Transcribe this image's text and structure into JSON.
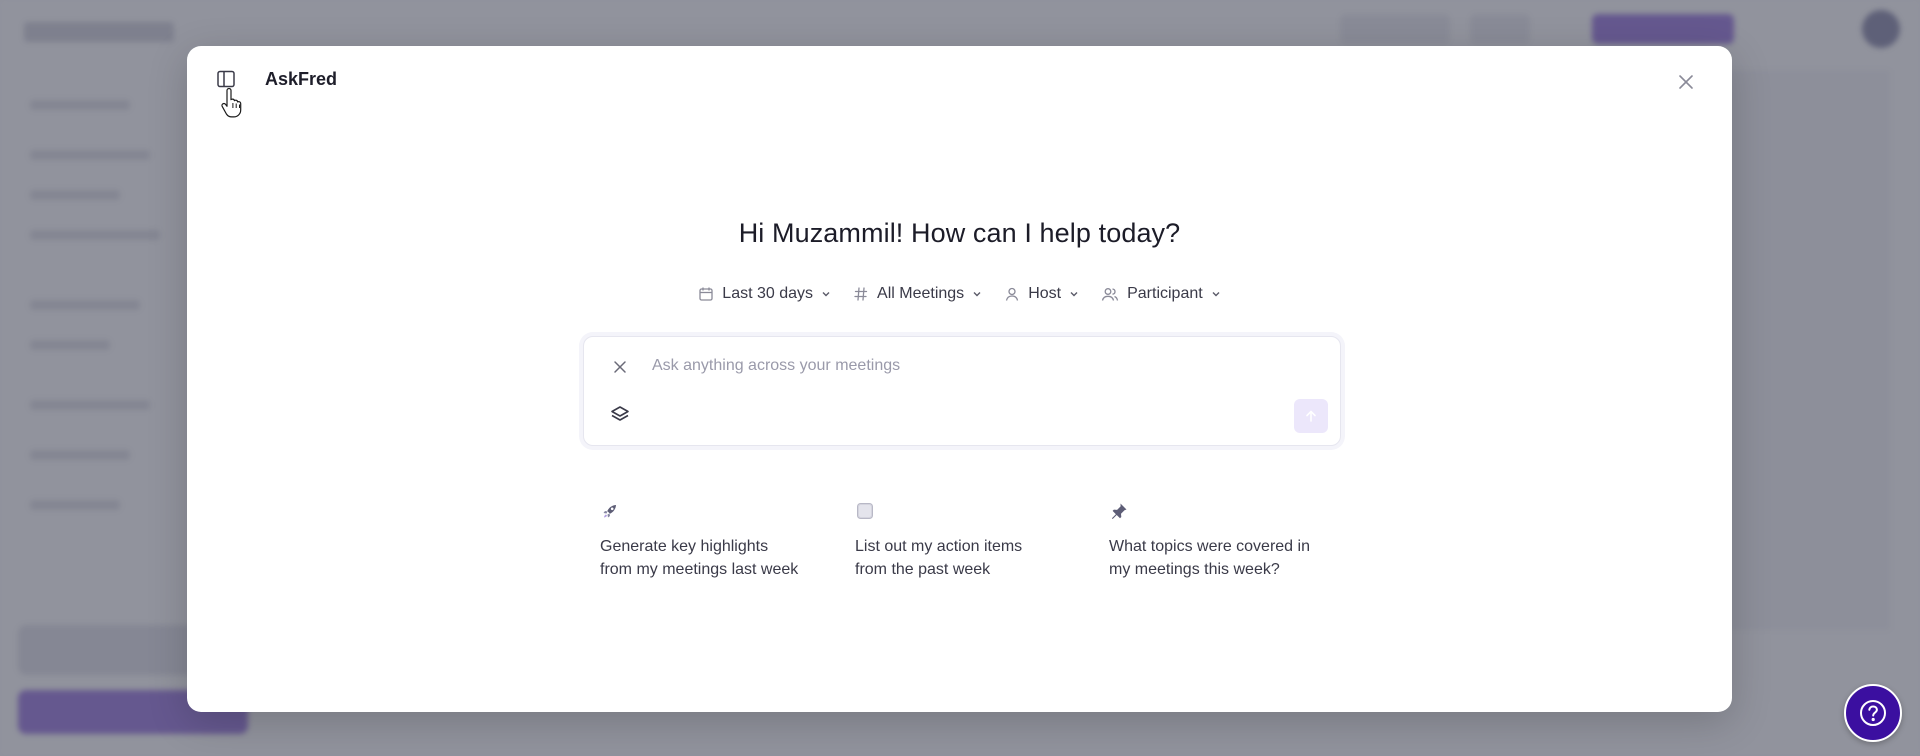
{
  "modal": {
    "title": "AskFred",
    "greeting": "Hi Muzammil! How can I help today?"
  },
  "filters": [
    {
      "label": "Last 30 days",
      "icon": "calendar-icon"
    },
    {
      "label": "All Meetings",
      "icon": "hashtag-icon"
    },
    {
      "label": "Host",
      "icon": "user-icon"
    },
    {
      "label": "Participant",
      "icon": "users-icon"
    }
  ],
  "composer": {
    "placeholder": "Ask anything across your meetings",
    "value": ""
  },
  "suggestions": [
    {
      "line1": "Generate key highlights",
      "line2": "from my meetings last week",
      "icon": "rocket-icon"
    },
    {
      "line1": "List out my action items",
      "line2": "from the past week",
      "icon": "checkbox-icon"
    },
    {
      "line1": "What topics were covered in",
      "line2": "my meetings this week?",
      "icon": "pushpin-icon"
    }
  ],
  "colors": {
    "accent": "#3b0fa0",
    "send_button_bg": "#ece7fb",
    "overlay": "#484c5c"
  }
}
